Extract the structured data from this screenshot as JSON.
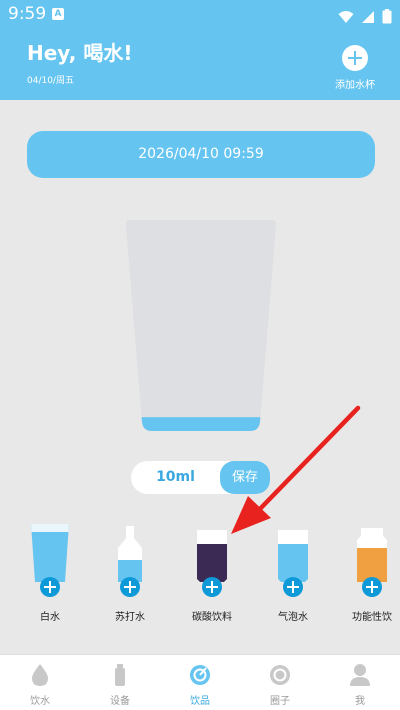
{
  "status_bar": {
    "time": "9:59",
    "notification_icon": "A",
    "icons": [
      "wifi-icon",
      "cellular-icon",
      "battery-icon"
    ]
  },
  "header": {
    "greeting": "Hey, 喝水!",
    "date": "04/10/周五",
    "add_cup_label": "添加水杯"
  },
  "datetime": "2026/04/10 09:59",
  "cup": {
    "fill_fraction": 0.07
  },
  "amount": {
    "value": "10ml",
    "save_label": "保存"
  },
  "drinks": [
    {
      "label": "白水",
      "icon": "water-glass-icon",
      "color": "#66c5f0"
    },
    {
      "label": "苏打水",
      "icon": "soda-bottle-icon",
      "color": "#66c5f0"
    },
    {
      "label": "碳酸饮料",
      "icon": "carbonated-can-icon",
      "color": "#3b2a54"
    },
    {
      "label": "气泡水",
      "icon": "sparkling-can-icon",
      "color": "#66c5f0"
    },
    {
      "label": "功能性饮",
      "icon": "functional-drink-icon",
      "color": "#f0a040"
    }
  ],
  "nav": [
    {
      "label": "饮水",
      "icon": "water-drop-icon",
      "active": false
    },
    {
      "label": "设备",
      "icon": "bottle-icon",
      "active": false
    },
    {
      "label": "饮品",
      "icon": "drinks-icon",
      "active": true
    },
    {
      "label": "圈子",
      "icon": "circle-icon",
      "active": false
    },
    {
      "label": "我",
      "icon": "profile-icon",
      "active": false
    }
  ],
  "colors": {
    "primary": "#66c5f0",
    "accent_dark": "#0e9ad8",
    "arrow": "#e8231f",
    "background": "#e8e8e8"
  }
}
